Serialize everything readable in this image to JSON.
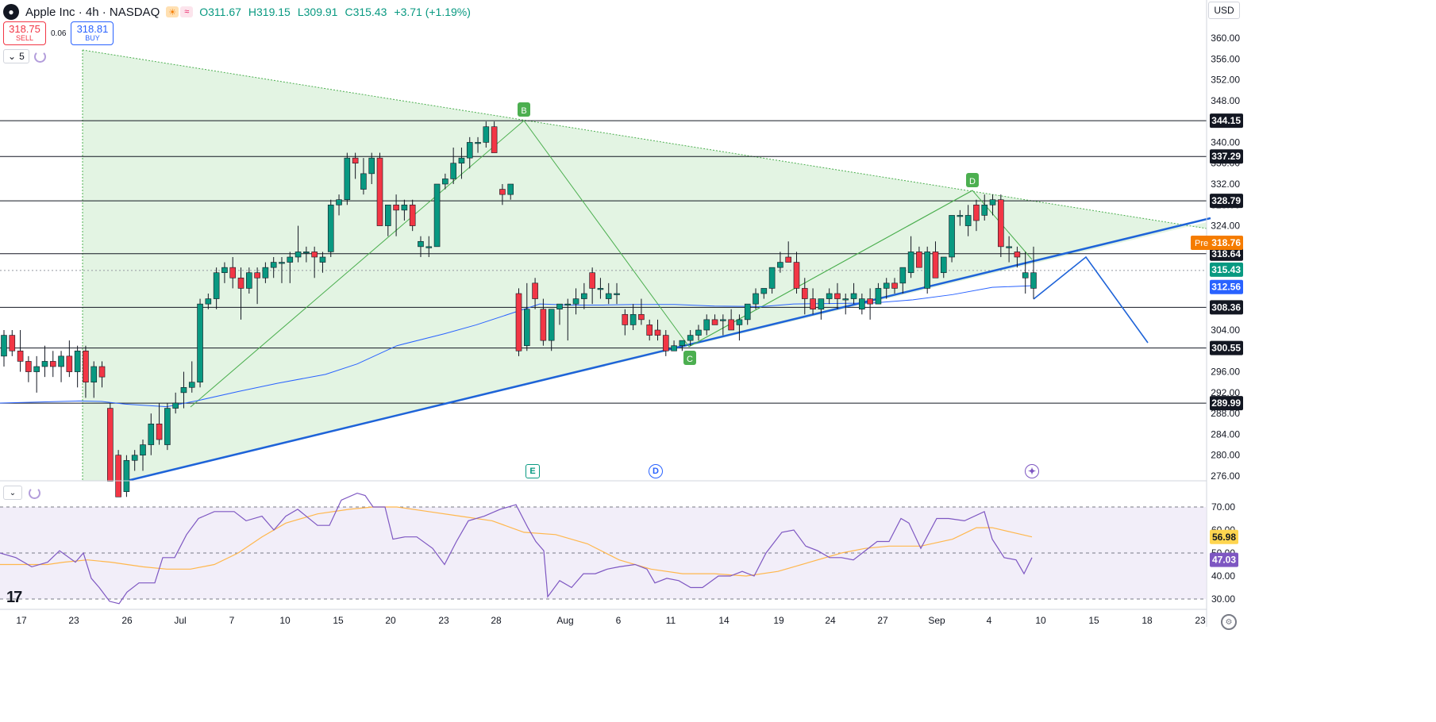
{
  "header": {
    "title": "Apple Inc · 4h · NASDAQ",
    "logo_icon": "apple-icon",
    "o": "O311.67",
    "h": "H319.15",
    "l": "L309.91",
    "c": "C315.43",
    "change": "+3.71 (+1.19%)"
  },
  "trade": {
    "sell_price": "318.75",
    "sell_label": "SELL",
    "spread": "0.06",
    "buy_price": "318.81",
    "buy_label": "BUY"
  },
  "indicator_count": "5",
  "currency": "USD",
  "colors": {
    "up": "#089981",
    "down": "#f23645",
    "ma": "#2962ff",
    "rsi": "#7e57c2",
    "rsi_ma": "#ffb74d",
    "triangle_fill": "#e1f3e1",
    "pattern": "#4caf50"
  },
  "price_axis": {
    "ticks": [
      "360.00",
      "356.00",
      "352.00",
      "348.00",
      "344.00",
      "340.00",
      "336.00",
      "332.00",
      "328.00",
      "324.00",
      "320.00",
      "316.00",
      "312.00",
      "308.00",
      "304.00",
      "300.00",
      "296.00",
      "292.00",
      "288.00",
      "284.00",
      "280.00",
      "276.00"
    ],
    "levels": [
      "344.15",
      "337.29",
      "328.79",
      "318.64",
      "308.36",
      "300.55",
      "289.99"
    ],
    "pre_label": "Pre",
    "pre_price": "318.76",
    "last_price": "315.43",
    "ma_price": "312.56"
  },
  "rsi_axis": {
    "ticks": [
      "70.00",
      "60.00",
      "50.00",
      "40.00",
      "30.00"
    ],
    "rsi_value": "47.03",
    "rsi_ma_value": "56.98"
  },
  "time_axis": [
    "17",
    "23",
    "26",
    "Jul",
    "7",
    "10",
    "15",
    "20",
    "23",
    "28",
    "Aug",
    "6",
    "11",
    "14",
    "19",
    "24",
    "27",
    "Sep",
    "4",
    "10",
    "15",
    "18",
    "23"
  ],
  "pattern_labels": {
    "b": "B",
    "c": "C",
    "d": "D"
  },
  "events": {
    "earnings": "E",
    "dividend": "D",
    "split_icon": "split-icon"
  },
  "chart_data": {
    "type": "candlestick",
    "interval": "4h",
    "ylim": [
      274,
      362
    ],
    "rsi_ylim": [
      25,
      77
    ],
    "horizontal_levels": [
      344.15,
      337.29,
      328.79,
      318.64,
      308.36,
      300.55,
      289.99
    ],
    "candles": [
      [
        299,
        304,
        297,
        303
      ],
      [
        303,
        304,
        299,
        300
      ],
      [
        300,
        304,
        296,
        298
      ],
      [
        298,
        299,
        294,
        296
      ],
      [
        296,
        299,
        292,
        297
      ],
      [
        297,
        301,
        295,
        298
      ],
      [
        298,
        300,
        295,
        297
      ],
      [
        297,
        300,
        294,
        299
      ],
      [
        299,
        302,
        295,
        296
      ],
      [
        296,
        301,
        293,
        300
      ],
      [
        300,
        301,
        291,
        294
      ],
      [
        294,
        298,
        291,
        297
      ],
      [
        297,
        298,
        293,
        295
      ],
      [
        289,
        290,
        275,
        275
      ],
      [
        280,
        281,
        272,
        272
      ],
      [
        273,
        280,
        272,
        279
      ],
      [
        279,
        281,
        277,
        280
      ],
      [
        280,
        283,
        277,
        282
      ],
      [
        282,
        288,
        280,
        286
      ],
      [
        286,
        290,
        282,
        283
      ],
      [
        282,
        290,
        281,
        289
      ],
      [
        289,
        292,
        288,
        290
      ],
      [
        292,
        296,
        289,
        293
      ],
      [
        293,
        298,
        292,
        294
      ],
      [
        294,
        310,
        293,
        309
      ],
      [
        309,
        311,
        308,
        310
      ],
      [
        310,
        316,
        308,
        315
      ],
      [
        315,
        317,
        313,
        316
      ],
      [
        316,
        318,
        312,
        314
      ],
      [
        314,
        316,
        306,
        312
      ],
      [
        312,
        316,
        311,
        315
      ],
      [
        315,
        316,
        309,
        314
      ],
      [
        314,
        317,
        313,
        316
      ],
      [
        316,
        318,
        314,
        317
      ],
      [
        317,
        318,
        313,
        317
      ],
      [
        317,
        319,
        313,
        318
      ],
      [
        318,
        324,
        317,
        319
      ],
      [
        319,
        320,
        317,
        319
      ],
      [
        319,
        320,
        314,
        318
      ],
      [
        317,
        319,
        315,
        318
      ],
      [
        319,
        329,
        318,
        328
      ],
      [
        328,
        330,
        326,
        329
      ],
      [
        329,
        338,
        328,
        337
      ],
      [
        337,
        338,
        333,
        336
      ],
      [
        331,
        337,
        330,
        334
      ],
      [
        334,
        338,
        332,
        337
      ],
      [
        337,
        338,
        324,
        324
      ],
      [
        324,
        328,
        322,
        328
      ],
      [
        328,
        330,
        322,
        327
      ],
      [
        327,
        329,
        325,
        328
      ],
      [
        328,
        329,
        323,
        324
      ],
      [
        320,
        322,
        318,
        321
      ],
      [
        320,
        322,
        318,
        320
      ],
      [
        320,
        332,
        320,
        332
      ],
      [
        332,
        334,
        331,
        333
      ],
      [
        333,
        339,
        332,
        336
      ],
      [
        336,
        339,
        333,
        337
      ],
      [
        337,
        341,
        335,
        340
      ],
      [
        340,
        341,
        338,
        340
      ],
      [
        340,
        344,
        339,
        343
      ],
      [
        343,
        344,
        338,
        338
      ],
      [
        331,
        332,
        328,
        330
      ],
      [
        330,
        332,
        329,
        332
      ],
      [
        311,
        312,
        299,
        300
      ],
      [
        301,
        313,
        300,
        308
      ],
      [
        313,
        314,
        308,
        310
      ],
      [
        308,
        310,
        301,
        302
      ],
      [
        302,
        308,
        300,
        308
      ],
      [
        308,
        309,
        305,
        309
      ],
      [
        309,
        310,
        302,
        309
      ],
      [
        309,
        312,
        307,
        310
      ],
      [
        310,
        313,
        308,
        311
      ],
      [
        315,
        316,
        309,
        312
      ],
      [
        312,
        314,
        310,
        312
      ],
      [
        310,
        313,
        309,
        311
      ],
      [
        311,
        313,
        309,
        311
      ],
      [
        307,
        308,
        303,
        305
      ],
      [
        305,
        309,
        304,
        307
      ],
      [
        307,
        310,
        305,
        306
      ],
      [
        305,
        306,
        302,
        303
      ],
      [
        304,
        306,
        302,
        303
      ],
      [
        303,
        304,
        299,
        300
      ],
      [
        300,
        302,
        300,
        301
      ],
      [
        301,
        302,
        300,
        302
      ],
      [
        302,
        304,
        301,
        303
      ],
      [
        303,
        305,
        302,
        304
      ],
      [
        304,
        307,
        303,
        306
      ],
      [
        306,
        307,
        305,
        305
      ],
      [
        306,
        307,
        303,
        306
      ],
      [
        306,
        308,
        304,
        304
      ],
      [
        305,
        307,
        302,
        306
      ],
      [
        306,
        309,
        305,
        309
      ],
      [
        309,
        312,
        308,
        311
      ],
      [
        311,
        312,
        310,
        312
      ],
      [
        312,
        316,
        311,
        316
      ],
      [
        316,
        319,
        315,
        317
      ],
      [
        318,
        321,
        317,
        317
      ],
      [
        317,
        319,
        311,
        312
      ],
      [
        312,
        314,
        307,
        310
      ],
      [
        310,
        312,
        307,
        308
      ],
      [
        308,
        310,
        306,
        310
      ],
      [
        310,
        312,
        309,
        311
      ],
      [
        311,
        313,
        308,
        310
      ],
      [
        310,
        311,
        307,
        310
      ],
      [
        310,
        313,
        309,
        311
      ],
      [
        308,
        311,
        307,
        310
      ],
      [
        310,
        312,
        306,
        309
      ],
      [
        309,
        313,
        309,
        312
      ],
      [
        312,
        314,
        310,
        313
      ],
      [
        313,
        314,
        311,
        312
      ],
      [
        313,
        316,
        311,
        316
      ],
      [
        315,
        322,
        314,
        319
      ],
      [
        319,
        320,
        316,
        316
      ],
      [
        312,
        320,
        311,
        319
      ],
      [
        319,
        321,
        314,
        314
      ],
      [
        315,
        318,
        314,
        318
      ],
      [
        318,
        326,
        317,
        326
      ],
      [
        326,
        327,
        324,
        326
      ],
      [
        324,
        328,
        322,
        326
      ],
      [
        328,
        329,
        323,
        325
      ],
      [
        326,
        330,
        325,
        328
      ],
      [
        328,
        330,
        326,
        329
      ],
      [
        329,
        330,
        318,
        320
      ],
      [
        320,
        322,
        317,
        320
      ],
      [
        319,
        320,
        316,
        318
      ],
      [
        314,
        319,
        311,
        315
      ],
      [
        312,
        320,
        310,
        315
      ]
    ],
    "ma": [
      [
        0,
        290
      ],
      [
        100,
        290.4
      ],
      [
        128,
        290.3
      ],
      [
        158,
        289.8
      ],
      [
        210,
        289.3
      ],
      [
        250,
        290.5
      ],
      [
        300,
        292.2
      ],
      [
        350,
        293.8
      ],
      [
        410,
        295.5
      ],
      [
        450,
        297.5
      ],
      [
        500,
        301
      ],
      [
        560,
        303.3
      ],
      [
        600,
        305
      ],
      [
        650,
        307.5
      ],
      [
        680,
        309
      ],
      [
        720,
        308.8
      ],
      [
        760,
        308.8
      ],
      [
        800,
        308.9
      ],
      [
        850,
        308.9
      ],
      [
        900,
        308.6
      ],
      [
        960,
        308.5
      ],
      [
        1000,
        309
      ],
      [
        1050,
        309.1
      ],
      [
        1100,
        309.2
      ],
      [
        1150,
        309.8
      ],
      [
        1200,
        310.8
      ],
      [
        1250,
        312.2
      ],
      [
        1300,
        312.5
      ]
    ],
    "rsi": [
      [
        0,
        50
      ],
      [
        20,
        48
      ],
      [
        40,
        44
      ],
      [
        60,
        46
      ],
      [
        75,
        51
      ],
      [
        95,
        46
      ],
      [
        105,
        50
      ],
      [
        115,
        39
      ],
      [
        125,
        35
      ],
      [
        138,
        29
      ],
      [
        150,
        28
      ],
      [
        160,
        33
      ],
      [
        175,
        37
      ],
      [
        195,
        37
      ],
      [
        205,
        48
      ],
      [
        220,
        48
      ],
      [
        235,
        58
      ],
      [
        250,
        65
      ],
      [
        270,
        68
      ],
      [
        295,
        68
      ],
      [
        310,
        64
      ],
      [
        330,
        66
      ],
      [
        345,
        60
      ],
      [
        360,
        66
      ],
      [
        375,
        69
      ],
      [
        400,
        62
      ],
      [
        415,
        62
      ],
      [
        430,
        73
      ],
      [
        450,
        76
      ],
      [
        460,
        75
      ],
      [
        470,
        70
      ],
      [
        485,
        70
      ],
      [
        495,
        56
      ],
      [
        510,
        57
      ],
      [
        525,
        57
      ],
      [
        545,
        52
      ],
      [
        560,
        45
      ],
      [
        575,
        55
      ],
      [
        590,
        64
      ],
      [
        610,
        66
      ],
      [
        630,
        69
      ],
      [
        650,
        71
      ],
      [
        665,
        61
      ],
      [
        675,
        55
      ],
      [
        685,
        51
      ],
      [
        690,
        31
      ],
      [
        705,
        38
      ],
      [
        720,
        35
      ],
      [
        735,
        41
      ],
      [
        750,
        41
      ],
      [
        765,
        43
      ],
      [
        780,
        44
      ],
      [
        800,
        45
      ],
      [
        815,
        43
      ],
      [
        825,
        37
      ],
      [
        840,
        39
      ],
      [
        855,
        38
      ],
      [
        870,
        35
      ],
      [
        885,
        35
      ],
      [
        905,
        40
      ],
      [
        920,
        40
      ],
      [
        935,
        42
      ],
      [
        950,
        40
      ],
      [
        965,
        50
      ],
      [
        985,
        59
      ],
      [
        1000,
        60
      ],
      [
        1015,
        53
      ],
      [
        1030,
        51
      ],
      [
        1045,
        48
      ],
      [
        1060,
        48
      ],
      [
        1075,
        47
      ],
      [
        1090,
        51
      ],
      [
        1105,
        55
      ],
      [
        1120,
        55
      ],
      [
        1135,
        65
      ],
      [
        1145,
        63
      ],
      [
        1160,
        52
      ],
      [
        1180,
        65
      ],
      [
        1195,
        65
      ],
      [
        1215,
        64
      ],
      [
        1240,
        68
      ],
      [
        1250,
        56
      ],
      [
        1265,
        48
      ],
      [
        1280,
        47
      ],
      [
        1290,
        41
      ],
      [
        1300,
        48
      ]
    ],
    "rsi_ma": [
      [
        0,
        45
      ],
      [
        60,
        45
      ],
      [
        80,
        46
      ],
      [
        110,
        47
      ],
      [
        140,
        46
      ],
      [
        180,
        44
      ],
      [
        210,
        43
      ],
      [
        240,
        43
      ],
      [
        270,
        45
      ],
      [
        300,
        50
      ],
      [
        330,
        57
      ],
      [
        360,
        63
      ],
      [
        400,
        67
      ],
      [
        440,
        69
      ],
      [
        470,
        70
      ],
      [
        500,
        70
      ],
      [
        540,
        68
      ],
      [
        580,
        66
      ],
      [
        620,
        64
      ],
      [
        660,
        59
      ],
      [
        700,
        58
      ],
      [
        740,
        54
      ],
      [
        780,
        47
      ],
      [
        820,
        43
      ],
      [
        860,
        41
      ],
      [
        900,
        41
      ],
      [
        940,
        40
      ],
      [
        980,
        42
      ],
      [
        1020,
        46
      ],
      [
        1060,
        50
      ],
      [
        1090,
        52
      ],
      [
        1120,
        53
      ],
      [
        1160,
        53
      ],
      [
        1200,
        56
      ],
      [
        1230,
        61
      ],
      [
        1250,
        61
      ],
      [
        1275,
        59
      ],
      [
        1300,
        57
      ]
    ]
  }
}
